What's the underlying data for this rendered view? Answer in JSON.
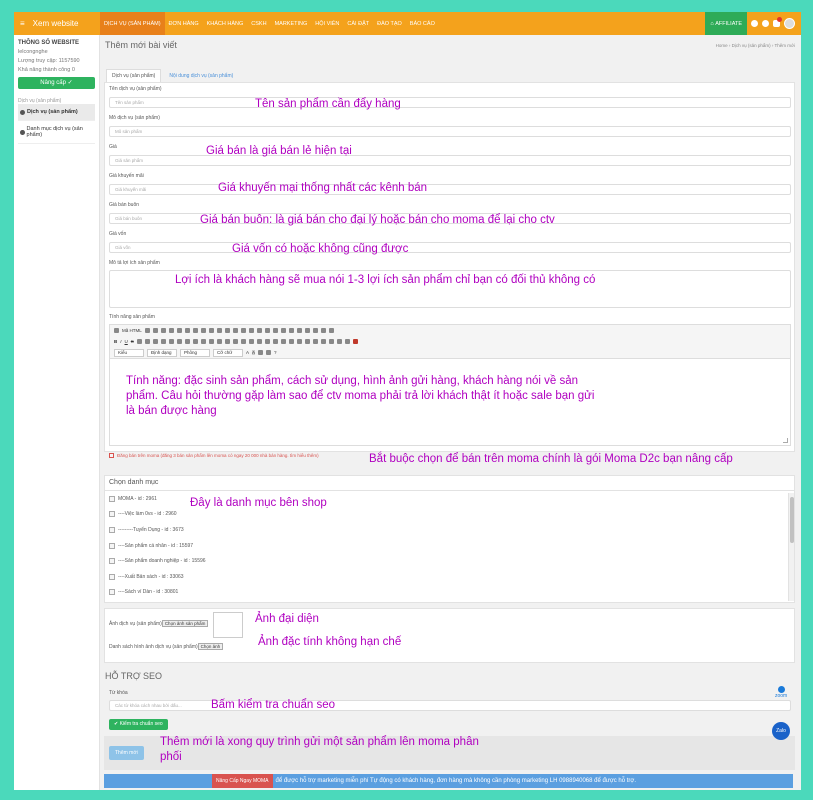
{
  "topbar": {
    "brand": "Xem website",
    "nav": [
      "DỊCH VỤ (SẢN PHẨM)",
      "ĐƠN HÀNG",
      "KHÁCH HÀNG",
      "CSKH",
      "MARKETING",
      "HỘI VIÊN",
      "CÀI ĐẶT",
      "ĐÀO TẠO",
      "BÁO CÁO"
    ],
    "affiliate": "AFFILIATE",
    "badge_count": "11"
  },
  "sidebar": {
    "title": "THÔNG SỐ WEBSITE",
    "lines": [
      "lelcongnghe",
      "Lượng truy cập: 1157590",
      "Khả năng thành công 0"
    ],
    "upgrade": "Nâng cấp",
    "section": "Dịch vụ (sản phẩm)",
    "items": [
      "Dịch vụ (sản phẩm)",
      "Danh mục dịch vụ (sản phẩm)"
    ]
  },
  "page": {
    "title": "Thêm mới bài viết",
    "breadcrumb": "Home › Dịch vụ (sản phẩm) › Thêm mới",
    "tabs": [
      "Dịch vụ (sản phẩm)",
      "Nội dung dịch vụ (sản phẩm)"
    ]
  },
  "form": {
    "name_label": "Tên dịch vụ (sản phẩm)",
    "name_ph": "Tên sản phẩm",
    "desc_label": "Mô dịch vụ (sản phẩm)",
    "desc_ph": "Mô sản phẩm",
    "price_label": "Giá",
    "price_ph": "Giá sản phẩm",
    "promo_label": "Giá khuyến mãi",
    "promo_ph": "Giá khuyến mãi",
    "wholesale_label": "Giá bán buôn",
    "wholesale_ph": "Giá bán buôn",
    "cost_label": "Giá vốn",
    "cost_ph": "Giá vốn",
    "benefit_label": "Mô tả lợi ích sản phẩm",
    "feature_label": "Tính năng sản phẩm",
    "editor_source": "Mã HTML",
    "editor_selects": [
      "Kiểu",
      "Định dạng",
      "Phông",
      "Cỡ chữ"
    ],
    "moma_warning": "Đăng bán trên moma (đăng 3 bán sản phẩm lên moma có ngay 20 000 nhà bán hàng. tìm hiểu thêm)"
  },
  "categories": {
    "title": "Chọn danh mục",
    "items": [
      "MOMA - id : 2961",
      "----Việc làm 0vs - id : 2960",
      "---------Tuyển Dụng - id : 3673",
      "----Sản phẩm cá nhân - id : 15597",
      "----Sản phẩm doanh nghiệp - id : 15596",
      "----Xuất Bản sách - id : 33063",
      "----Sách ví Dàn - id : 30801"
    ]
  },
  "images": {
    "avatar_label": "Ảnh dịch vụ (sản phẩm)",
    "avatar_btn": "Chọn ảnh sản phẩm",
    "gallery_label": "Danh sách hình ảnh dịch vụ (sản phẩm)",
    "gallery_btn": "Chọn ảnh"
  },
  "seo": {
    "title": "HỖ TRỢ SEO",
    "keyword_label": "Từ khóa",
    "keyword_ph": "Các từ khóa cách nhau bởi dấu...",
    "check_btn": "Kiểm tra chuẩn seo",
    "zoom": "zoom"
  },
  "submit": "Thêm mới",
  "zalo": "Zalo",
  "banner": {
    "btn": "Nâng Cấp Ngay MOMA",
    "text": "để được hỗ trợ marketing miễn phí Tự động có khách hàng, đơn hàng mà không cần phòng marketing LH 0988940068 để được hỗ trợ."
  },
  "annotations": {
    "name": "Tên sản phẩm cần đẩy hàng",
    "price": "Giá bán là giá bán lẻ hiện tại",
    "promo": "Giá khuyến mại thống nhất các kênh bán",
    "wholesale": "Giá bán buôn: là giá bán cho đại lý hoặc bán cho moma để lại cho ctv",
    "cost": "Giá vốn có hoặc không cũng được",
    "benefit": "Lợi ích là khách hàng sẽ mua nói 1-3 lợi ích sản phẩm chỉ bạn có đối thủ không có",
    "feature": "Tính năng: đặc sinh sản phẩm, cách sử dụng, hình ảnh gửi hàng, khách hàng nói về sản phẩm. Câu hỏi thường gặp làm sao để ctv moma phải trả lời khách thật ít hoặc sale bạn gửi là bán được hàng",
    "moma": "Bắt buộc chọn để bán trên moma chính là gói Moma D2c bạn nâng cấp",
    "category": "Đây là danh mục bên shop",
    "avatar": "Ảnh đại diện",
    "gallery": "Ảnh đặc tính không hạn chế",
    "seo": "Bấm kiểm tra chuẩn seo",
    "submit": "Thêm mới là xong quy trình gửi một sản phẩm lên moma phân phối"
  }
}
